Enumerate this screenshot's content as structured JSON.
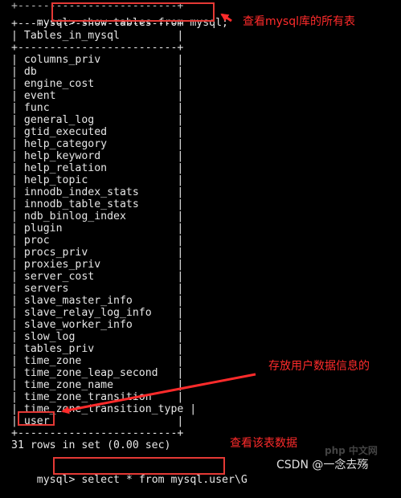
{
  "terminal": {
    "top_cmd": {
      "prompt": "mysql>",
      "command": "show tables from mysql;"
    },
    "partial_border_top": "+-------------------------+",
    "header_border": "+-------------------------+",
    "header_cell": "| Tables_in_mysql         |",
    "header_sep": "+-------------------------+",
    "rows": [
      "| columns_priv            |",
      "| db                      |",
      "| engine_cost             |",
      "| event                   |",
      "| func                    |",
      "| general_log             |",
      "| gtid_executed           |",
      "| help_category           |",
      "| help_keyword            |",
      "| help_relation           |",
      "| help_topic              |",
      "| innodb_index_stats      |",
      "| innodb_table_stats      |",
      "| ndb_binlog_index        |",
      "| plugin                  |",
      "| proc                    |",
      "| procs_priv              |",
      "| proxies_priv            |",
      "| server_cost             |",
      "| servers                 |",
      "| slave_master_info       |",
      "| slave_relay_log_info    |",
      "| slave_worker_info       |",
      "| slow_log                |",
      "| tables_priv             |",
      "| time_zone               |",
      "| time_zone_leap_second   |",
      "| time_zone_name          |",
      "| time_zone_transition    |",
      "| time_zone_transition_type |",
      "| user                    |"
    ],
    "footer_border": "+-------------------------+",
    "row_count": "31 rows in set (0.00 sec)",
    "bottom_cmd": {
      "prompt": "mysql>",
      "command": "select * from mysql.user\\G"
    }
  },
  "annotations": {
    "view_all_tables": "查看mysql库的所有表",
    "store_user_data": "存放用户数据信息的",
    "view_table_data": "查看该表数据"
  },
  "watermark": {
    "ghost_logo": "php 中文网",
    "text": "CSDN @一念去殇"
  },
  "colors": {
    "background": "#000000",
    "terminal_text": "#e6e6e6",
    "annotation": "#ff2b2b",
    "highlight_box": "#e53935"
  }
}
